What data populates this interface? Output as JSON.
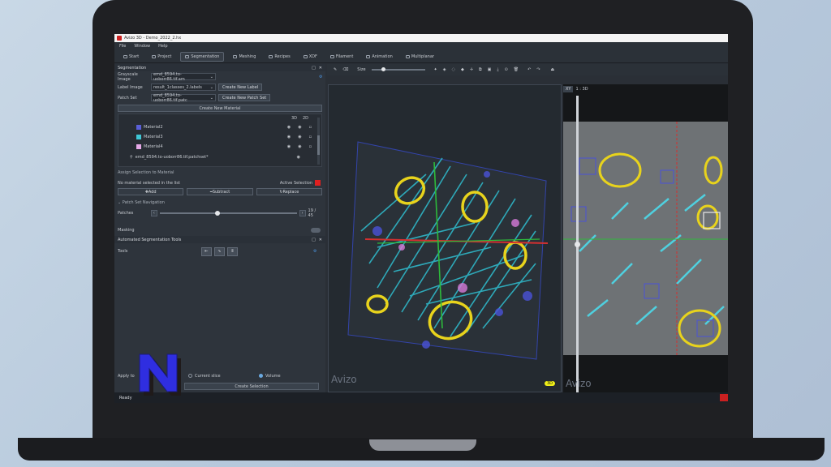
{
  "app": {
    "title": "Avizo 3D - Demo_2022_2.hx",
    "menu": [
      "File",
      "Window",
      "Help"
    ],
    "tabs": [
      {
        "label": "Start",
        "icon": "home-icon"
      },
      {
        "label": "Project",
        "icon": "project-icon"
      },
      {
        "label": "Segmentation",
        "icon": "segmentation-icon",
        "active": true
      },
      {
        "label": "Meshing",
        "icon": "meshing-icon"
      },
      {
        "label": "Recipes",
        "icon": "recipes-icon"
      },
      {
        "label": "XDF",
        "icon": "xdf-icon"
      },
      {
        "label": "Filament",
        "icon": "filament-icon"
      },
      {
        "label": "Animation",
        "icon": "animation-icon"
      },
      {
        "label": "Multiplanar",
        "icon": "multiplanar-icon"
      }
    ]
  },
  "segmentation": {
    "title": "Segmentation",
    "grayscale_label": "Grayscale Image",
    "grayscale_value": "emd_8594.to-uoborr86.tif.am",
    "label_image_label": "Label Image",
    "label_image_value": "result_1classes_2.labels",
    "create_label_btn": "Create New Label",
    "patch_set_label": "Patch Set",
    "patch_set_value": "emd_8594.to-uoborr86.tif.patc",
    "create_patch_btn": "Create New Patch Set",
    "create_material_btn": "Create New Material",
    "col_3d": "3D",
    "col_2d": "2D",
    "materials": [
      {
        "name": "Material2",
        "color": "#5a5fd8"
      },
      {
        "name": "Material3",
        "color": "#3fc7d6"
      },
      {
        "name": "Material4",
        "color": "#e6a9e8"
      }
    ],
    "patch_file": "emd_8594.to-uoborr86.tif.patchset*",
    "assign_title": "Assign Selection to Material",
    "no_material_text": "No material selected in the list",
    "active_selection_label": "Active Selection",
    "active_selection_color": "#e02020",
    "add_btn": "Add",
    "subtract_btn": "Subtract",
    "replace_btn": "Replace",
    "patch_nav_title": "Patch Set Navigation",
    "patches_label": "Patches",
    "patch_position": "19 / 45",
    "patch_fraction": 0.42,
    "masking_label": "Masking"
  },
  "auto_tools": {
    "title": "Automated Segmentation Tools",
    "tools_label": "Tools",
    "apply_to_label": "Apply to",
    "current_slice": "Current slice",
    "volume": "Volume",
    "volume_selected": true,
    "create_selection_btn": "Create Selection"
  },
  "viewer": {
    "size_label": "Size",
    "watermark": "Avizo",
    "badge_3d": "3D",
    "view2d_label": "1 : 3D",
    "axis_letter": "XY"
  },
  "status": {
    "text": "Ready"
  }
}
